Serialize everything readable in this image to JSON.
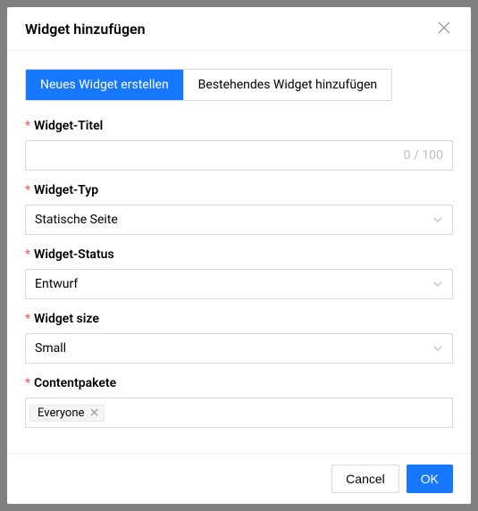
{
  "modal": {
    "title": "Widget hinzufügen"
  },
  "tabs": {
    "create": "Neues Widget erstellen",
    "existing": "Bestehendes Widget hinzufügen"
  },
  "form": {
    "title_label": "Widget-Titel",
    "title_value": "",
    "title_count": "0 / 100",
    "type_label": "Widget-Typ",
    "type_value": "Statische Seite",
    "status_label": "Widget-Status",
    "status_value": "Entwurf",
    "size_label": "Widget size",
    "size_value": "Small",
    "content_label": "Contentpakete",
    "content_tag": "Everyone"
  },
  "footer": {
    "cancel": "Cancel",
    "ok": "OK"
  }
}
